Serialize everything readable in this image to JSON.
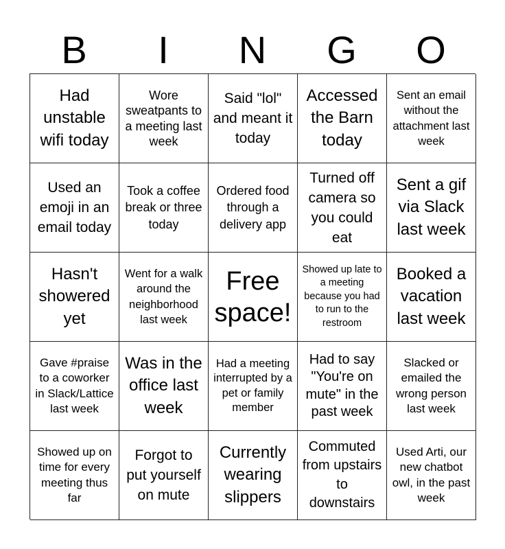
{
  "card": {
    "header_letters": [
      "B",
      "I",
      "N",
      "G",
      "O"
    ],
    "cells": [
      "Had unstable wifi today",
      "Wore sweatpants to a meeting last week",
      "Said \"lol\" and meant it today",
      "Accessed the Barn today",
      "Sent an email without the attachment last week",
      "Used an emoji in an email today",
      "Took a coffee break or three today",
      "Ordered food through a delivery app",
      "Turned off camera so you could eat",
      "Sent a gif via Slack last week",
      "Hasn't showered yet",
      "Went for a walk around the neighborhood last week",
      "Free space!",
      "Showed up late to a meeting because you had to run to the restroom",
      "Booked a vacation last week",
      "Gave #praise to a coworker in Slack/Lattice last week",
      "Was in the office last week",
      "Had a meeting interrupted by a pet or family member",
      "Had to say \"You're on mute\" in the past week",
      "Slacked or emailed the wrong person last week",
      "Showed up on time for every meeting thus far",
      "Forgot to put yourself on mute",
      "Currently wearing slippers",
      "Commuted from upstairs to downstairs",
      "Used Arti, our new chatbot owl, in the past week"
    ],
    "free_space_index": 12
  }
}
